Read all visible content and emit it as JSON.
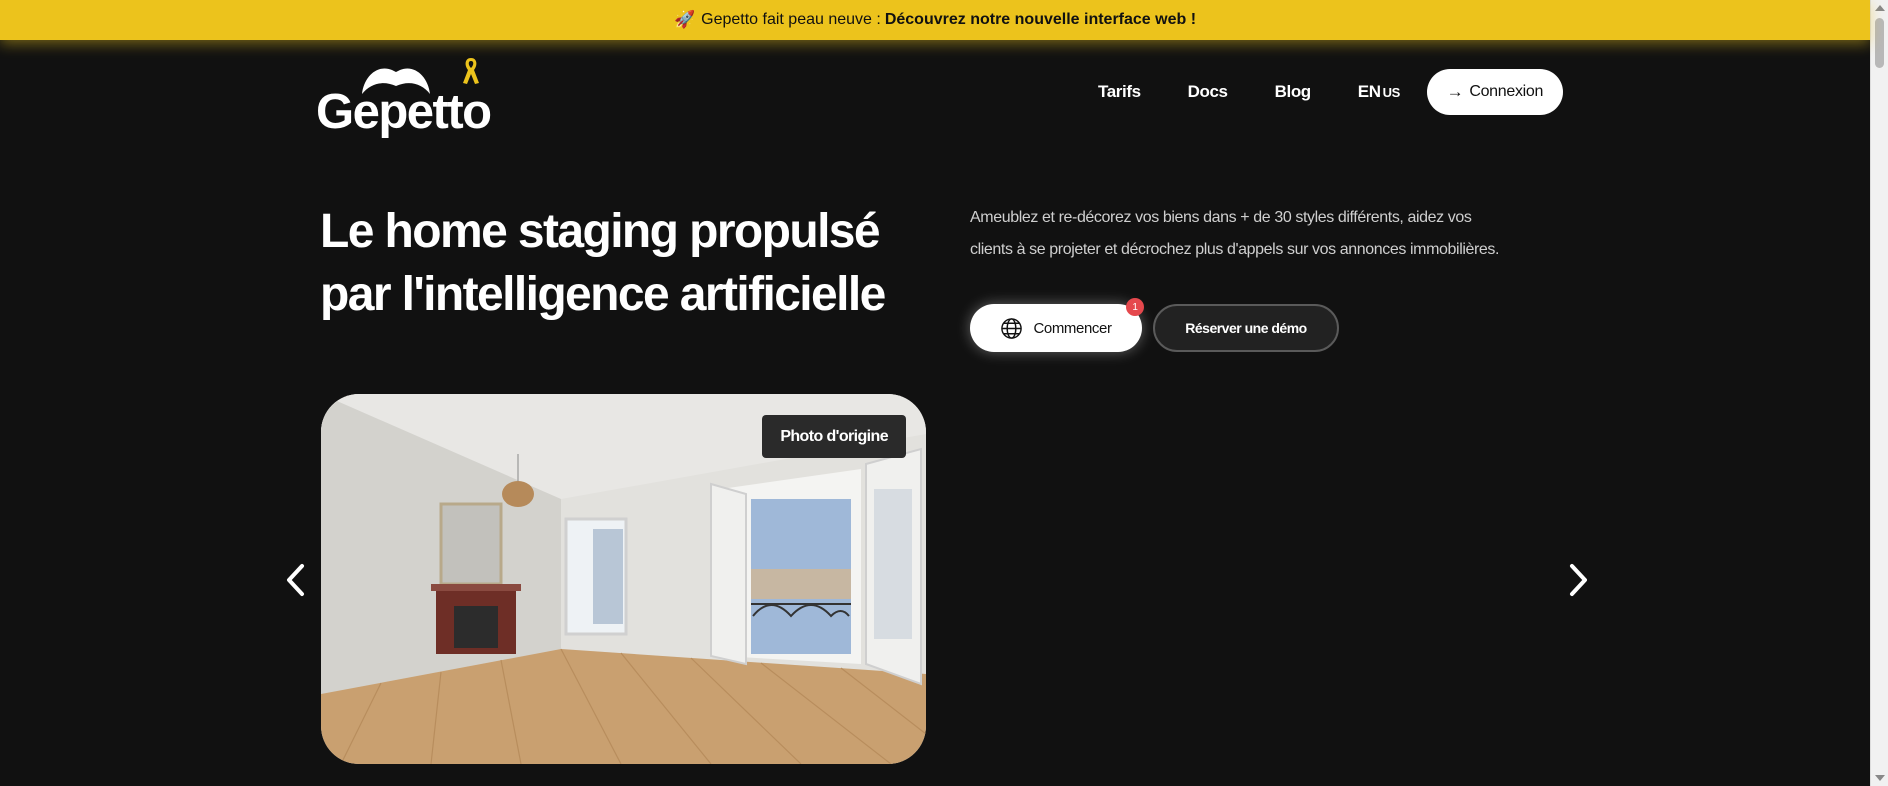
{
  "announcement": {
    "icon": "rocket-icon",
    "text": "Gepetto fait peau neuve :",
    "highlight": "Découvrez notre nouvelle interface web !",
    "background": "#ecc31c"
  },
  "header": {
    "logo_text": "Gepetto",
    "nav": [
      "Tarifs",
      "Docs",
      "Blog"
    ],
    "lang": "EN",
    "region": "US",
    "login_label": "Connexion"
  },
  "hero": {
    "title_line1": "Le home staging propulsé",
    "title_line2": "par l'intelligence artificielle",
    "description_line1": "Ameublez et re-décorez vos biens dans + de 30 styles différents, aidez vos",
    "description_line2": "clients à se projeter et décrochez plus d'appels sur vos annonces immobilières.",
    "cta_primary": "Commencer",
    "cta_primary_badge": "1",
    "cta_secondary": "Réserver une démo"
  },
  "carousel": {
    "image_label": "Photo d'origine",
    "prev_icon": "chevron-left-icon",
    "next_icon": "chevron-right-icon"
  },
  "colors": {
    "background": "#111111",
    "accent": "#ecc31c",
    "badge": "#e5484d"
  }
}
